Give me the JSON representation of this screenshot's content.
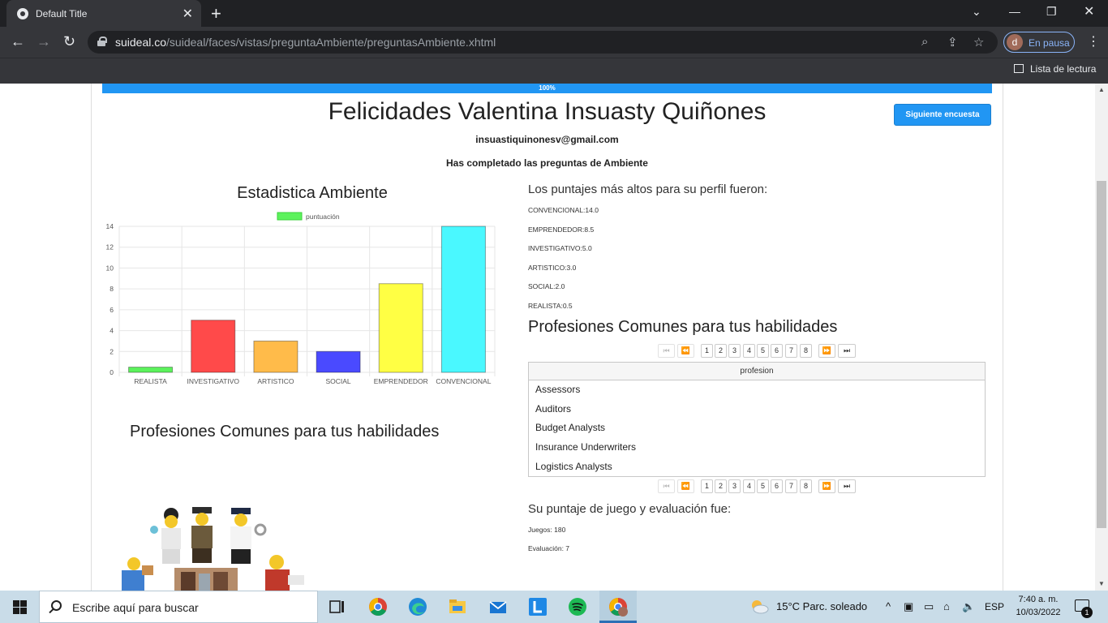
{
  "browser": {
    "tab_title": "Default Title",
    "url_host": "suideal.co",
    "url_path": "/suideal/faces/vistas/preguntaAmbiente/preguntasAmbiente.xhtml",
    "profile_initial": "d",
    "profile_status": "En pausa",
    "reading_list": "Lista de lectura"
  },
  "page": {
    "progress_label": "100%",
    "progress_value": 100,
    "congrats_title": "Felicidades Valentina Insuasty Quiñones",
    "next_button": "Siguiente encuesta",
    "email": "insuastiquinonesv@gmail.com",
    "completed_text": "Has completado las preguntas de Ambiente",
    "chart_title": "Estadistica Ambiente",
    "professions_heading": "Profesiones Comunes para tus habilidades",
    "scores_heading": "Los puntajes más altos para su perfil fueron:",
    "scores": [
      "CONVENCIONAL:14.0",
      "EMPRENDEDOR:8.5",
      "INVESTIGATIVO:5.0",
      "ARTISTICO:3.0",
      "SOCIAL:2.0",
      "REALISTA:0.5"
    ],
    "table_header": "profesion",
    "professions": [
      "Assessors",
      "Auditors",
      "Budget Analysts",
      "Insurance Underwriters",
      "Logistics Analysts"
    ],
    "paginator": {
      "first": "⏮",
      "prev": "⏪",
      "pages": [
        "1",
        "2",
        "3",
        "4",
        "5",
        "6",
        "7",
        "8"
      ],
      "next": "⏩",
      "last": "⏭"
    },
    "game_heading": "Su puntaje de juego y evaluación fue:",
    "game_score": "Juegos: 180",
    "evaluation_score": "Evaluación: 7"
  },
  "chart_data": {
    "type": "bar",
    "categories": [
      "REALISTA",
      "INVESTIGATIVO",
      "ARTISTICO",
      "SOCIAL",
      "EMPRENDEDOR",
      "CONVENCIONAL"
    ],
    "series": [
      {
        "name": "puntuación",
        "values": [
          0.5,
          5,
          3,
          2,
          8.5,
          14
        ],
        "colors": [
          "#5cf25c",
          "#ff4a4a",
          "#ffbb4a",
          "#4a4aff",
          "#ffff44",
          "#4af8ff"
        ]
      }
    ],
    "legend_color": "#5cf25c",
    "yticks": [
      "0",
      "2",
      "4",
      "6",
      "8",
      "10",
      "12",
      "14"
    ],
    "ylim": [
      0,
      14
    ],
    "grid": true,
    "legend": "top"
  },
  "taskbar": {
    "search_placeholder": "Escribe aquí para buscar",
    "weather": "15°C  Parc. soleado",
    "language": "ESP",
    "time": "7:40 a. m.",
    "date": "10/03/2022",
    "notifications": "1"
  }
}
